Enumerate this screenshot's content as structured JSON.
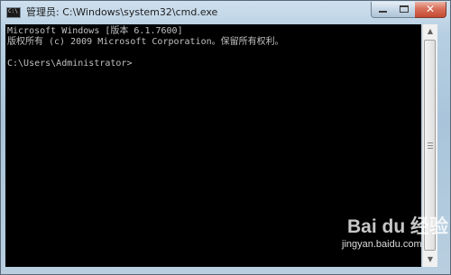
{
  "window": {
    "title": "管理员: C:\\Windows\\system32\\cmd.exe",
    "app_icon": "cmd-icon",
    "icon_text": "C:\\"
  },
  "controls": {
    "minimize": "minimize-icon",
    "maximize": "maximize-icon",
    "close": "close-icon",
    "close_glyph": "✕"
  },
  "console": {
    "background": "#000000",
    "text_color": "#c0c0c0",
    "lines": [
      "Microsoft Windows [版本 6.1.7600]",
      "版权所有 (c) 2009 Microsoft Corporation。保留所有权利。",
      "",
      "C:\\Users\\Administrator>"
    ]
  },
  "scrollbar": {
    "up_glyph": "▲",
    "down_glyph": "▼"
  },
  "watermark": {
    "brand": "Bai du 经验",
    "url": "jingyan.baidu.com"
  }
}
